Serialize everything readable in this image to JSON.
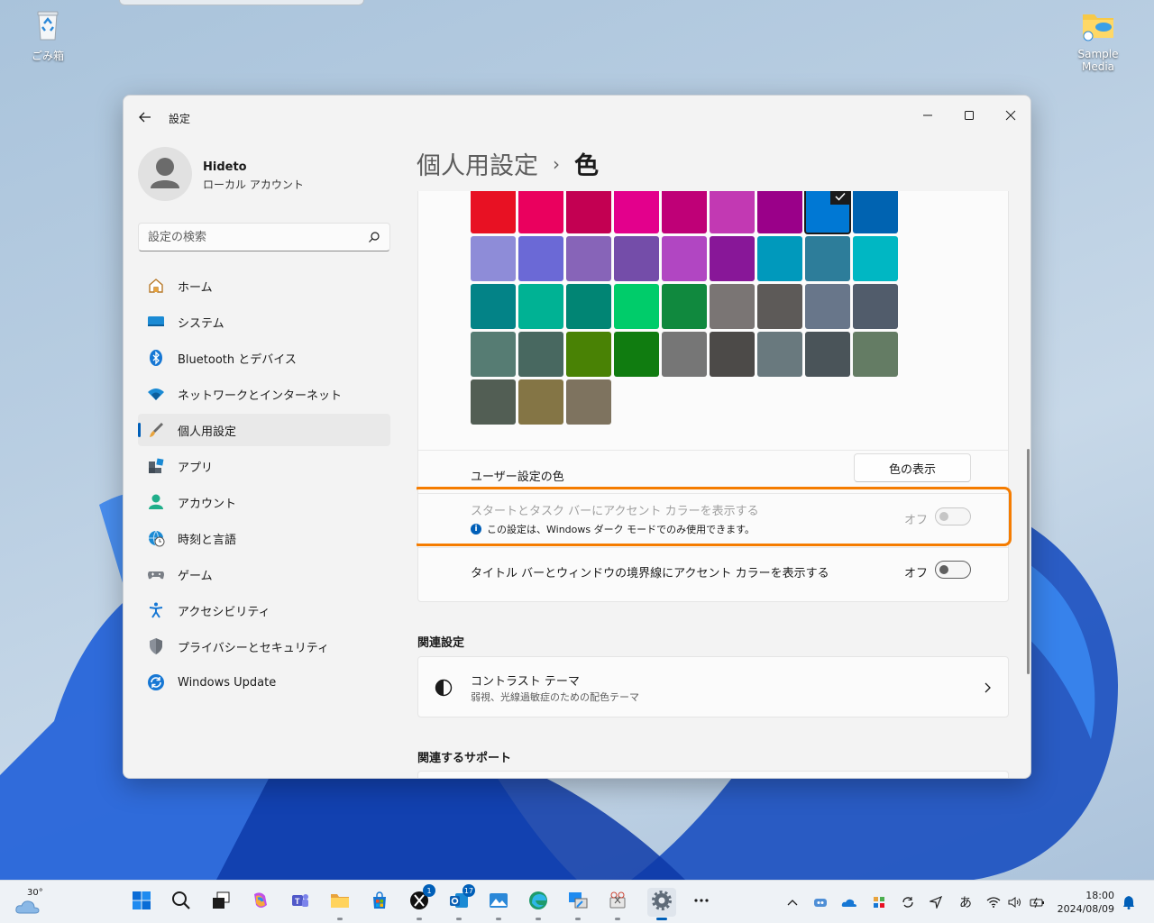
{
  "desktop": {
    "recycle_bin": "ごみ箱",
    "sample_media": "Sample Media"
  },
  "window": {
    "app_title": "設定",
    "user": {
      "name": "Hideto",
      "account_type": "ローカル アカウント"
    },
    "search": {
      "placeholder": "設定の検索"
    },
    "nav": [
      {
        "label": "ホーム",
        "icon": "home-icon"
      },
      {
        "label": "システム",
        "icon": "system-icon"
      },
      {
        "label": "Bluetooth とデバイス",
        "icon": "bluetooth-icon"
      },
      {
        "label": "ネットワークとインターネット",
        "icon": "network-icon"
      },
      {
        "label": "個人用設定",
        "icon": "personalization-icon",
        "active": true
      },
      {
        "label": "アプリ",
        "icon": "apps-icon"
      },
      {
        "label": "アカウント",
        "icon": "account-icon"
      },
      {
        "label": "時刻と言語",
        "icon": "time-language-icon"
      },
      {
        "label": "ゲーム",
        "icon": "gaming-icon"
      },
      {
        "label": "アクセシビリティ",
        "icon": "accessibility-icon"
      },
      {
        "label": "プライバシーとセキュリティ",
        "icon": "privacy-icon"
      },
      {
        "label": "Windows Update",
        "icon": "windows-update-icon"
      }
    ],
    "breadcrumb": {
      "parent": "個人用設定",
      "current": "色"
    },
    "accent_colors": [
      [
        "#e81123",
        "#ea005e",
        "#c30052",
        "#e3008c",
        "#bf0077",
        "#c239b3",
        "#9a0089",
        "#0078d4",
        "#0063b1"
      ],
      [
        "#8e8cd8",
        "#6b69d6",
        "#8764b8",
        "#744da9",
        "#b146c2",
        "#881798",
        "#0099bc",
        "#2d7d9a",
        "#00b7c3"
      ],
      [
        "#038387",
        "#00b294",
        "#018574",
        "#00cc6a",
        "#10893e",
        "#7a7574",
        "#5d5a58",
        "#68768a",
        "#515c6b"
      ],
      [
        "#567c73",
        "#486860",
        "#498205",
        "#107c10",
        "#767676",
        "#4c4a48",
        "#69797e",
        "#4a5459",
        "#647c64"
      ],
      [
        "#525e54",
        "#847545",
        "#7e735f"
      ]
    ],
    "selected_color": "#0078d4",
    "custom_color": {
      "label": "ユーザー設定の色",
      "button": "色の表示"
    },
    "accent_start_taskbar": {
      "label": "スタートとタスク バーにアクセント カラーを表示する",
      "note": "この設定は、Windows ダーク モードでのみ使用できます。",
      "state": "オフ",
      "enabled": false
    },
    "accent_title_bars": {
      "label": "タイトル バーとウィンドウの境界線にアクセント カラーを表示する",
      "state": "オフ"
    },
    "related_settings": {
      "title": "関連設定",
      "contrast_title": "コントラスト テーマ",
      "contrast_desc": "弱視、光線過敏症のための配色テーマ"
    },
    "related_support": {
      "title": "関連するサポート"
    }
  },
  "taskbar": {
    "weather_temp": "30°",
    "apps": [
      {
        "name": "start-icon"
      },
      {
        "name": "search-icon"
      },
      {
        "name": "task-view-icon"
      },
      {
        "name": "copilot-icon"
      },
      {
        "name": "teams-icon"
      },
      {
        "name": "file-explorer-icon"
      },
      {
        "name": "store-icon"
      },
      {
        "name": "x-app-icon",
        "badge": "1"
      },
      {
        "name": "outlook-icon",
        "badge": "17"
      },
      {
        "name": "photos-icon"
      },
      {
        "name": "edge-icon"
      },
      {
        "name": "remote-desktop-icon"
      },
      {
        "name": "snipping-tool-icon"
      },
      {
        "name": "settings-icon",
        "active": true
      },
      {
        "name": "more-icon"
      }
    ],
    "ime": "あ",
    "time": "18:00",
    "date": "2024/08/09"
  }
}
